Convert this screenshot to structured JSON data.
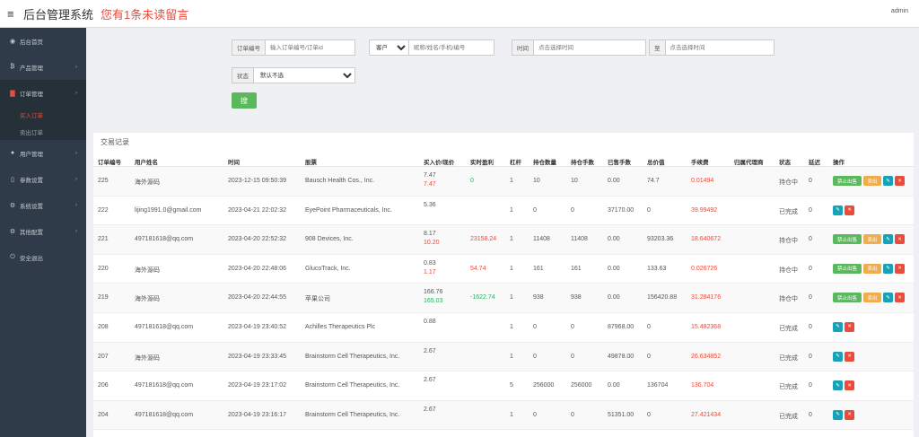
{
  "header": {
    "title": "后台管理系统",
    "notice": "您有1条未读留言",
    "admin": "admin"
  },
  "sidebar": {
    "items": [
      {
        "label": "后台首页",
        "icon": "dashboard-icon",
        "has_arrow": false
      },
      {
        "label": "产品管理",
        "icon": "bitcoin-icon",
        "has_arrow": true
      },
      {
        "label": "订单管理",
        "icon": "file-icon",
        "has_arrow": true,
        "open": true
      },
      {
        "label": "用户管理",
        "icon": "user-icon",
        "has_arrow": true
      },
      {
        "label": "参数设置",
        "icon": "file-icon",
        "has_arrow": true
      },
      {
        "label": "系统设置",
        "icon": "cogs-icon",
        "has_arrow": true
      },
      {
        "label": "其他配置",
        "icon": "cogs-icon",
        "has_arrow": true
      },
      {
        "label": "安全退出",
        "icon": "power-icon",
        "has_arrow": false
      }
    ],
    "sub_items": [
      "买入订单",
      "卖出订单"
    ]
  },
  "filters": {
    "order_label": "订单编号",
    "order_placeholder": "输入订单编号/订单id",
    "customer_select": "客户",
    "customer_placeholder": "昵称/姓名/手机/编号",
    "time_label": "时间",
    "time_placeholder": "点击选择时间",
    "to_label": "至",
    "to_placeholder": "点击选择时间",
    "status_label": "状态",
    "status_value": "默认不选",
    "search_label": "搜"
  },
  "panel": {
    "title": "交易记录"
  },
  "table": {
    "headers": [
      "订单编号",
      "用户姓名",
      "时间",
      "股票",
      "买入价/现价",
      "实时盈利",
      "杠杆",
      "持仓数量",
      "持仓手数",
      "已售手数",
      "总价值",
      "手续费",
      "归属代理商",
      "状态",
      "延迟",
      "操作"
    ],
    "buttons": {
      "ban": "禁止出售",
      "sell": "卖出"
    },
    "rows": [
      {
        "id": "225",
        "user": "海外源码",
        "time": "2023-12-15 09:50:39",
        "stock": "Bausch Health Cos., Inc.",
        "buy": "7.47",
        "cur": "7.47",
        "cur_color": "red",
        "profit": "0",
        "profit_color": "green",
        "lever": "1",
        "qty": "10",
        "hands": "10",
        "sold": "0.00",
        "total": "74.7",
        "fee": "0.01494",
        "agent": "",
        "status": "持仓中",
        "delay": "0",
        "actions": true
      },
      {
        "id": "222",
        "user": "lijing1991.0@gmail.com",
        "time": "2023-04-21 22:02:32",
        "stock": "EyePoint Pharmaceuticals, Inc.",
        "buy": "5.36",
        "cur": "",
        "cur_color": "red",
        "profit": "",
        "profit_color": "red",
        "lever": "1",
        "qty": "0",
        "hands": "0",
        "sold": "37170.00",
        "total": "0",
        "fee": "39.99492",
        "agent": "",
        "status": "已完成",
        "delay": "0",
        "actions": false
      },
      {
        "id": "221",
        "user": "497181618@qq.com",
        "time": "2023-04-20 22:52:32",
        "stock": "908 Devices, Inc.",
        "buy": "8.17",
        "cur": "10.20",
        "cur_color": "red",
        "profit": "23158.24",
        "profit_color": "red",
        "lever": "1",
        "qty": "11408",
        "hands": "11408",
        "sold": "0.00",
        "total": "93203.36",
        "fee": "18.640672",
        "agent": "",
        "status": "持仓中",
        "delay": "0",
        "actions": true
      },
      {
        "id": "220",
        "user": "海外源码",
        "time": "2023-04-20 22:48:06",
        "stock": "GlucoTrack, Inc.",
        "buy": "0.83",
        "cur": "1.17",
        "cur_color": "red",
        "profit": "54.74",
        "profit_color": "red",
        "lever": "1",
        "qty": "161",
        "hands": "161",
        "sold": "0.00",
        "total": "133.63",
        "fee": "0.026726",
        "agent": "",
        "status": "持仓中",
        "delay": "0",
        "actions": true
      },
      {
        "id": "219",
        "user": "海外源码",
        "time": "2023-04-20 22:44:55",
        "stock": "苹果公司",
        "buy": "166.76",
        "cur": "165.03",
        "cur_color": "green",
        "profit": "-1622.74",
        "profit_color": "green",
        "lever": "1",
        "qty": "938",
        "hands": "938",
        "sold": "0.00",
        "total": "156420.88",
        "fee": "31.284176",
        "agent": "",
        "status": "持仓中",
        "delay": "0",
        "actions": true
      },
      {
        "id": "208",
        "user": "497181618@qq.com",
        "time": "2023-04-19 23:40:52",
        "stock": "Achilles Therapeutics Plc",
        "buy": "0.88",
        "cur": "",
        "cur_color": "red",
        "profit": "",
        "profit_color": "red",
        "lever": "1",
        "qty": "0",
        "hands": "0",
        "sold": "87968.00",
        "total": "0",
        "fee": "15.482368",
        "agent": "",
        "status": "已完成",
        "delay": "0",
        "actions": false
      },
      {
        "id": "207",
        "user": "海外源码",
        "time": "2023-04-19 23:33:45",
        "stock": "Brainstorm Cell Therapeutics, Inc.",
        "buy": "2.67",
        "cur": "",
        "cur_color": "red",
        "profit": "",
        "profit_color": "red",
        "lever": "1",
        "qty": "0",
        "hands": "0",
        "sold": "49878.00",
        "total": "0",
        "fee": "26.634852",
        "agent": "",
        "status": "已完成",
        "delay": "0",
        "actions": false
      },
      {
        "id": "206",
        "user": "497181618@qq.com",
        "time": "2023-04-19 23:17:02",
        "stock": "Brainstorm Cell Therapeutics, Inc.",
        "buy": "2.67",
        "cur": "",
        "cur_color": "red",
        "profit": "",
        "profit_color": "red",
        "lever": "5",
        "qty": "256000",
        "hands": "256000",
        "sold": "0.00",
        "total": "136704",
        "fee": "136.704",
        "agent": "",
        "status": "已完成",
        "delay": "0",
        "actions": false
      },
      {
        "id": "204",
        "user": "497181618@qq.com",
        "time": "2023-04-19 23:16:17",
        "stock": "Brainstorm Cell Therapeutics, Inc.",
        "buy": "2.67",
        "cur": "",
        "cur_color": "red",
        "profit": "",
        "profit_color": "red",
        "lever": "1",
        "qty": "0",
        "hands": "0",
        "sold": "51351.00",
        "total": "0",
        "fee": "27.421434",
        "agent": "",
        "status": "已完成",
        "delay": "0",
        "actions": false
      }
    ]
  }
}
